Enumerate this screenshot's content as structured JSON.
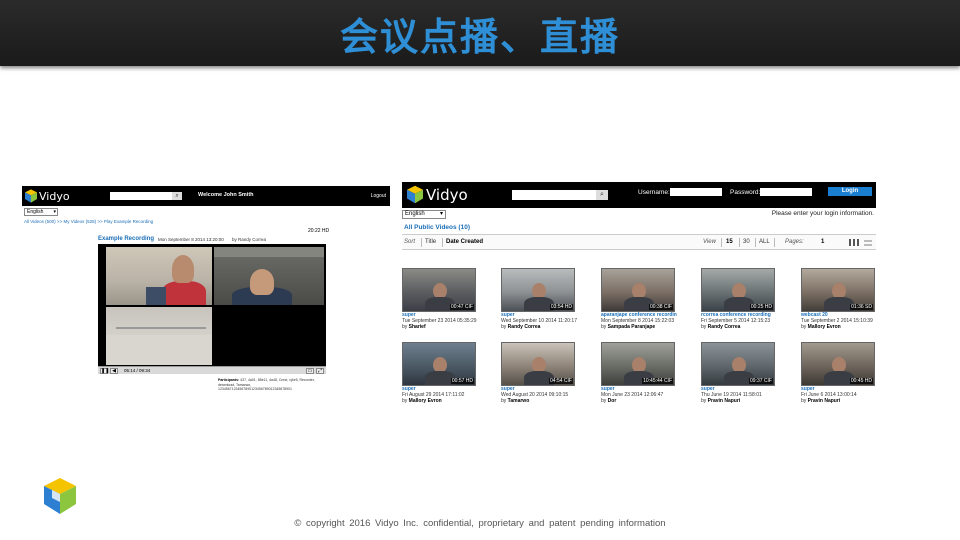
{
  "slide": {
    "title": "会议点播、直播",
    "copyright": "© copyright  2016 Vidyo Inc.  confidential,  proprietary  and  patent pending  information"
  },
  "colors": {
    "title_blue": "#2e8fd6",
    "link_blue": "#1b6fb8",
    "login_button": "#1a7fd0"
  },
  "left_screen": {
    "brand": "Vidyo",
    "search_icon": "search-icon",
    "welcome": "Welcome  John Smith",
    "logout": "Logout",
    "language": "English",
    "breadcrumb": "All Videos (500) >> My Videos (528) >> Play Example Recording",
    "quality": "20:22 HD",
    "recording_title": "Example Recording",
    "recording_date": "Mon September 8 2014 13:20:00",
    "recording_by": "by  Randy Correa",
    "player": {
      "time": "05:14 / 09:34",
      "pause_icon": "pause-icon",
      "volume_icon": "volume-icon",
      "fullscreen_icon": "fullscreen-icon",
      "chat_icon": "chat-icon"
    },
    "participants_label": "Participants:",
    "participants_text": " 437, 4a01, 58e11, 4a48, Crest, vj4e5, Recorder, derwnload, Tamarwo, 12345671234567890123456789012345678901"
  },
  "right_screen": {
    "brand": "Vidyo",
    "search_icon": "search-icon",
    "username_label": "Username:",
    "password_label": "Password:",
    "login_button": "Login",
    "language": "English",
    "login_info": "Please enter your login information.",
    "all_public": "All Public Videos (10)",
    "sort": {
      "label": "Sort",
      "options": [
        "Title",
        "Date Created"
      ],
      "view_label": "View",
      "view_options": [
        "15",
        "30",
        "ALL"
      ],
      "pages_label": "Pages:",
      "page": "1",
      "grid_icon": "grid-view-icon",
      "list_icon": "list-view-icon"
    },
    "videos": [
      {
        "title": "super",
        "date": "Tue September 23 2014 05:35:29",
        "by": "Sharief",
        "badge": "00:47 CIF"
      },
      {
        "title": "super",
        "date": "Wed September 10 2014 11:20:17",
        "by": "Randy Correa",
        "badge": "03:54 HD"
      },
      {
        "title": "aparanjape conference recordin",
        "date": "Mon September 8 2014 15:22:03",
        "by": "Sampada Paranjape",
        "badge": "00:38 CIF"
      },
      {
        "title": "rcorrea conference recording",
        "date": "Fri September 5 2014 12:15:23",
        "by": "Randy Correa",
        "badge": "00:25 HD"
      },
      {
        "title": "webcast 20",
        "date": "Tue September 2 2014 15:10:39",
        "by": "Mallory Evron",
        "badge": "01:36 SD"
      },
      {
        "title": "super",
        "date": "Fri August 29 2014 17:11:02",
        "by": "Mallory Evron",
        "badge": "00:57 HD"
      },
      {
        "title": "super",
        "date": "Wed August 20 2014 09:10:15",
        "by": "Tamarwo",
        "badge": "04:54 CIF"
      },
      {
        "title": "super",
        "date": "Mon June 23 2014 12:06:47",
        "by": "Dor",
        "badge": "10:45:44 CIF"
      },
      {
        "title": "super",
        "date": "Thu June 19 2014 11:58:01",
        "by": "Pravin Napuri",
        "badge": "09:37 CIF"
      },
      {
        "title": "super",
        "date": "Fri June 6 2014 13:00:14",
        "by": "Pravin Napuri",
        "badge": "00:45 HD"
      }
    ]
  }
}
